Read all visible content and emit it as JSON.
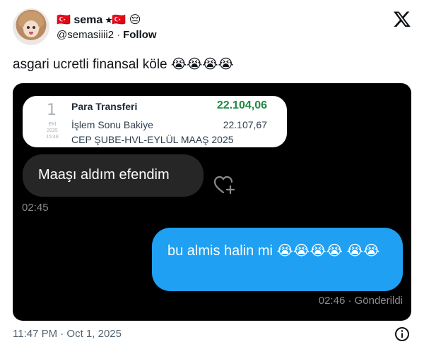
{
  "author": {
    "display_name": "🇹🇷 sema ⭑🇹🇷 😔",
    "handle": "@semasiiii2",
    "separator": "·",
    "follow_label": "Follow"
  },
  "tweet": {
    "text": "asgari ucretli finansal köle 😭😭😭😭"
  },
  "media": {
    "receipt": {
      "day": "1",
      "month": "EKİ",
      "year": "2025",
      "time": "15:48",
      "title": "Para Transferi",
      "amount": "22.104,06",
      "balance_label": "İşlem Sonu Bakiye",
      "balance_value": "22.107,67",
      "description": "CEP ŞUBE-HVL-EYLÜL MAAŞ 2025"
    },
    "incoming_message": "Maaşı aldım efendim",
    "incoming_time": "02:45",
    "outgoing_message": "bu almis halin mi 😭😭😭😭 😭😭",
    "outgoing_status": "02:46 · Gönderildi"
  },
  "footer": {
    "timestamp": "11:47 PM · Oct 1, 2025"
  },
  "colors": {
    "accent_blue": "#1fa0f2",
    "amount_green": "#1e8a44",
    "media_bg": "#000000"
  },
  "icons": [
    "x-logo-icon",
    "heart-add-icon",
    "info-icon"
  ]
}
